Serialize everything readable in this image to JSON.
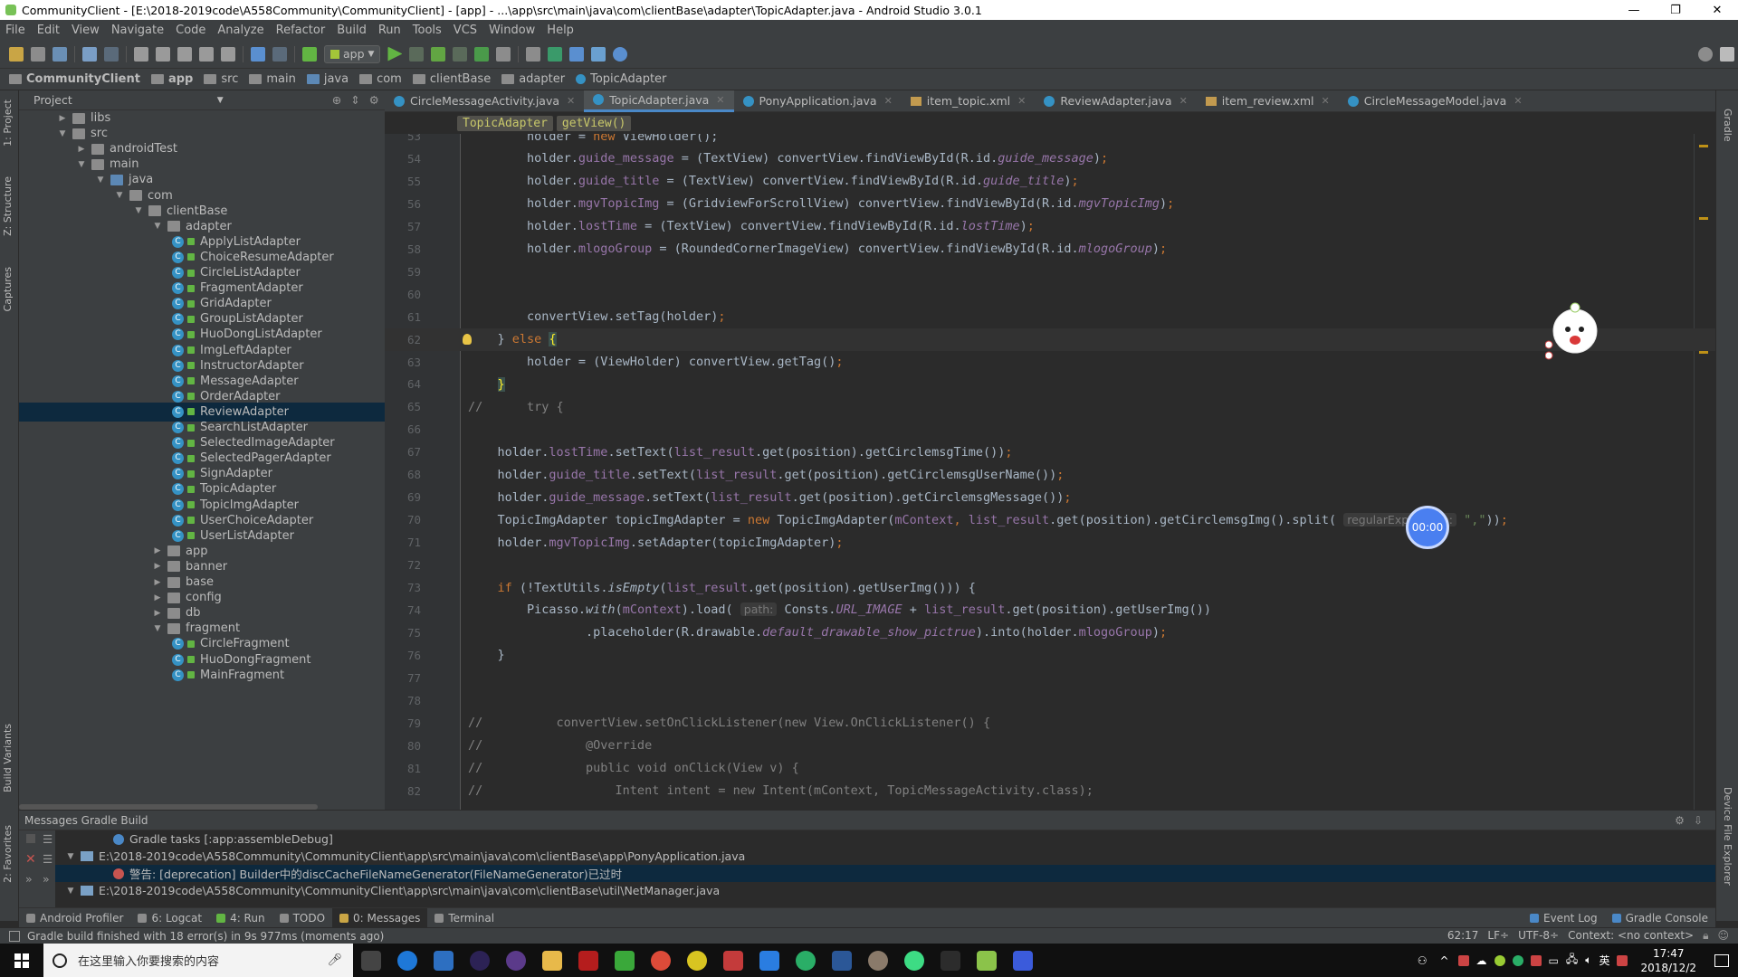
{
  "title_bar": {
    "title": "CommunityClient - [E:\\2018-2019code\\A558Community\\CommunityClient] - [app] - ...\\app\\src\\main\\java\\com\\clientBase\\adapter\\TopicAdapter.java - Android Studio 3.0.1",
    "minimize": "—",
    "maximize": "❐",
    "close": "✕"
  },
  "menu": [
    "File",
    "Edit",
    "View",
    "Navigate",
    "Code",
    "Analyze",
    "Refactor",
    "Build",
    "Run",
    "Tools",
    "VCS",
    "Window",
    "Help"
  ],
  "toolbar": {
    "app_config": "app"
  },
  "breadcrumbs": [
    "CommunityClient",
    "app",
    "src",
    "main",
    "java",
    "com",
    "clientBase",
    "adapter",
    "TopicAdapter"
  ],
  "left_strip": {
    "project": "1: Project",
    "structure": "Z: Structure",
    "captures": "Captures",
    "build_variants": "Build Variants",
    "favorites": "2: Favorites"
  },
  "right_strip": {
    "gradle": "Gradle",
    "device_explorer": "Device File Explorer"
  },
  "project_panel": {
    "header": "Project",
    "tree": [
      {
        "label": "libs",
        "depth": 3,
        "kind": "folder",
        "arrow": "▶"
      },
      {
        "label": "src",
        "depth": 3,
        "kind": "folder",
        "arrow": "▼"
      },
      {
        "label": "androidTest",
        "depth": 4,
        "kind": "folder",
        "arrow": "▶"
      },
      {
        "label": "main",
        "depth": 4,
        "kind": "folder",
        "arrow": "▼"
      },
      {
        "label": "java",
        "depth": 5,
        "kind": "bfolder",
        "arrow": "▼"
      },
      {
        "label": "com",
        "depth": 6,
        "kind": "folder",
        "arrow": "▼"
      },
      {
        "label": "clientBase",
        "depth": 7,
        "kind": "folder",
        "arrow": "▼"
      },
      {
        "label": "adapter",
        "depth": 8,
        "kind": "folder",
        "arrow": "▼"
      },
      {
        "label": "ApplyListAdapter",
        "depth": 9,
        "kind": "class"
      },
      {
        "label": "ChoiceResumeAdapter",
        "depth": 9,
        "kind": "class"
      },
      {
        "label": "CircleListAdapter",
        "depth": 9,
        "kind": "class"
      },
      {
        "label": "FragmentAdapter",
        "depth": 9,
        "kind": "class"
      },
      {
        "label": "GridAdapter",
        "depth": 9,
        "kind": "class"
      },
      {
        "label": "GroupListAdapter",
        "depth": 9,
        "kind": "class"
      },
      {
        "label": "HuoDongListAdapter",
        "depth": 9,
        "kind": "class"
      },
      {
        "label": "ImgLeftAdapter",
        "depth": 9,
        "kind": "class"
      },
      {
        "label": "InstructorAdapter",
        "depth": 9,
        "kind": "class"
      },
      {
        "label": "MessageAdapter",
        "depth": 9,
        "kind": "class"
      },
      {
        "label": "OrderAdapter",
        "depth": 9,
        "kind": "class"
      },
      {
        "label": "ReviewAdapter",
        "depth": 9,
        "kind": "class",
        "selected": true
      },
      {
        "label": "SearchListAdapter",
        "depth": 9,
        "kind": "class"
      },
      {
        "label": "SelectedImageAdapter",
        "depth": 9,
        "kind": "class"
      },
      {
        "label": "SelectedPagerAdapter",
        "depth": 9,
        "kind": "class"
      },
      {
        "label": "SignAdapter",
        "depth": 9,
        "kind": "class"
      },
      {
        "label": "TopicAdapter",
        "depth": 9,
        "kind": "class"
      },
      {
        "label": "TopicImgAdapter",
        "depth": 9,
        "kind": "class"
      },
      {
        "label": "UserChoiceAdapter",
        "depth": 9,
        "kind": "class"
      },
      {
        "label": "UserListAdapter",
        "depth": 9,
        "kind": "class"
      },
      {
        "label": "app",
        "depth": 8,
        "kind": "folder",
        "arrow": "▶"
      },
      {
        "label": "banner",
        "depth": 8,
        "kind": "folder",
        "arrow": "▶"
      },
      {
        "label": "base",
        "depth": 8,
        "kind": "folder",
        "arrow": "▶"
      },
      {
        "label": "config",
        "depth": 8,
        "kind": "folder",
        "arrow": "▶"
      },
      {
        "label": "db",
        "depth": 8,
        "kind": "folder",
        "arrow": "▶"
      },
      {
        "label": "fragment",
        "depth": 8,
        "kind": "folder",
        "arrow": "▼"
      },
      {
        "label": "CircleFragment",
        "depth": 9,
        "kind": "class"
      },
      {
        "label": "HuoDongFragment",
        "depth": 9,
        "kind": "class"
      },
      {
        "label": "MainFragment",
        "depth": 9,
        "kind": "class"
      }
    ]
  },
  "editor_tabs": [
    {
      "label": "CircleMessageActivity.java",
      "type": "java"
    },
    {
      "label": "TopicAdapter.java",
      "type": "java",
      "active": true
    },
    {
      "label": "PonyApplication.java",
      "type": "java"
    },
    {
      "label": "item_topic.xml",
      "type": "xml"
    },
    {
      "label": "ReviewAdapter.java",
      "type": "java"
    },
    {
      "label": "item_review.xml",
      "type": "xml"
    },
    {
      "label": "CircleMessageModel.java",
      "type": "java"
    }
  ],
  "editor_breadcrumb": [
    "TopicAdapter",
    "getView()"
  ],
  "code_lines": [
    {
      "n": "53",
      "html": "        holder = <span class='kw'>new</span> ViewHolder();"
    },
    {
      "n": "54",
      "html": "        holder.<span class='fld'>guide_message</span> = (TextView) convertView.findViewById(R.id.<span class='itf'>guide_message</span>)<span class='kw'>;</span>"
    },
    {
      "n": "55",
      "html": "        holder.<span class='fld'>guide_title</span> = (TextView) convertView.findViewById(R.id.<span class='itf'>guide_title</span>)<span class='kw'>;</span>"
    },
    {
      "n": "56",
      "html": "        holder.<span class='fld'>mgvTopicImg</span> = (GridviewForScrollView) convertView.findViewById(R.id.<span class='itf'>mgvTopicImg</span>)<span class='kw'>;</span>"
    },
    {
      "n": "57",
      "html": "        holder.<span class='fld'>lostTime</span> = (TextView) convertView.findViewById(R.id.<span class='itf'>lostTime</span>)<span class='kw'>;</span>"
    },
    {
      "n": "58",
      "html": "        holder.<span class='fld'>mlogoGroup</span> = (RoundedCornerImageView) convertView.findViewById(R.id.<span class='itf'>mlogoGroup</span>)<span class='kw'>;</span>"
    },
    {
      "n": "59",
      "html": ""
    },
    {
      "n": "60",
      "html": ""
    },
    {
      "n": "61",
      "html": "        convertView.setTag(holder)<span class='kw'>;</span>"
    },
    {
      "n": "62",
      "html": "    } <span class='kw'>else</span> <span class='brace'>{</span>",
      "cur": true
    },
    {
      "n": "63",
      "html": "        holder = (ViewHolder) convertView.getTag()<span class='kw'>;</span>"
    },
    {
      "n": "64",
      "html": "    <span class='brace'>}</span>"
    },
    {
      "n": "65",
      "html": "<span class='cm'>//      try {</span>"
    },
    {
      "n": "66",
      "html": ""
    },
    {
      "n": "67",
      "html": "    holder.<span class='fld'>lostTime</span>.setText(<span class='fld'>list_result</span>.get(position).getCirclemsgTime())<span class='kw'>;</span>"
    },
    {
      "n": "68",
      "html": "    holder.<span class='fld'>guide_title</span>.setText(<span class='fld'>list_result</span>.get(position).getCirclemsgUserName())<span class='kw'>;</span>"
    },
    {
      "n": "69",
      "html": "    holder.<span class='fld'>guide_message</span>.setText(<span class='fld'>list_result</span>.get(position).getCirclemsgMessage())<span class='kw'>;</span>"
    },
    {
      "n": "70",
      "html": "    TopicImgAdapter topicImgAdapter = <span class='kw'>new</span> TopicImgAdapter(<span class='fld'>mContext</span><span class='kw'>,</span> <span class='fld'>list_result</span>.get(position).getCirclemsgImg().split( <span class='hint'>regularExpression:</span> <span class='str'>\",\"</span>))<span class='kw'>;</span>"
    },
    {
      "n": "71",
      "html": "    holder.<span class='fld'>mgvTopicImg</span>.setAdapter(topicImgAdapter)<span class='kw'>;</span>"
    },
    {
      "n": "72",
      "html": ""
    },
    {
      "n": "73",
      "html": "    <span class='kw'>if</span> (!TextUtils.<span class='st'>isEmpty</span>(<span class='fld'>list_result</span>.get(position).getUserImg())) {"
    },
    {
      "n": "74",
      "html": "        Picasso.<span class='st'>with</span>(<span class='fld'>mContext</span>).load( <span class='hint'>path:</span> Consts.<span class='itf'>URL_IMAGE</span> + <span class='fld'>list_result</span>.get(position).getUserImg())"
    },
    {
      "n": "75",
      "html": "                .placeholder(R.drawable.<span class='itf'>default_drawable_show_pictrue</span>).into(holder.<span class='fld'>mlogoGroup</span>)<span class='kw'>;</span>"
    },
    {
      "n": "76",
      "html": "    }"
    },
    {
      "n": "77",
      "html": ""
    },
    {
      "n": "78",
      "html": ""
    },
    {
      "n": "79",
      "html": "<span class='cm'>//          convertView.setOnClickListener(new View.OnClickListener() {</span>"
    },
    {
      "n": "80",
      "html": "<span class='cm'>//              @Override</span>"
    },
    {
      "n": "81",
      "html": "<span class='cm'>//              public void onClick(View v) {</span>"
    },
    {
      "n": "82",
      "html": "<span class='cm'>//                  Intent intent = new Intent(mContext, TopicMessageActivity.class);</span>"
    }
  ],
  "timer_overlay": "00:00",
  "messages_panel": {
    "header": "Messages Gradle Build",
    "rows": [
      {
        "icon": "info",
        "text": "Gradle tasks [:app:assembleDebug]"
      },
      {
        "icon": "file",
        "text": "E:\\2018-2019code\\A558Community\\CommunityClient\\app\\src\\main\\java\\com\\clientBase\\app\\PonyApplication.java",
        "arrow": "▼"
      },
      {
        "icon": "error",
        "text": "警告: [deprecation] Builder中的discCacheFileNameGenerator(FileNameGenerator)已过时",
        "selected": true
      },
      {
        "icon": "file",
        "text": "E:\\2018-2019code\\A558Community\\CommunityClient\\app\\src\\main\\java\\com\\clientBase\\util\\NetManager.java",
        "arrow": "▼"
      }
    ]
  },
  "tool_windows": [
    {
      "label": "Android Profiler",
      "color": "#8c8c8c"
    },
    {
      "label": "6: Logcat",
      "color": "#8c8c8c"
    },
    {
      "label": "4: Run",
      "color": "#62b543"
    },
    {
      "label": "TODO",
      "color": "#8c8c8c"
    },
    {
      "label": "0: Messages",
      "color": "#c9a545",
      "active": true
    },
    {
      "label": "Terminal",
      "color": "#8c8c8c"
    }
  ],
  "tool_windows_right": [
    {
      "label": "Event Log"
    },
    {
      "label": "Gradle Console"
    }
  ],
  "status_bar": {
    "message": "Gradle build finished with 18 error(s) in 9s 977ms (moments ago)",
    "position": "62:17",
    "line_sep": "LF÷",
    "encoding": "UTF-8÷",
    "context": "Context: <no context>"
  },
  "taskbar": {
    "search_placeholder": "在这里输入你要搜索的内容",
    "time": "17:47",
    "date": "2018/12/2",
    "ime": "英",
    "apps": [
      {
        "name": "task-view",
        "color": "#444444"
      },
      {
        "name": "edge",
        "color": "#1e78d8"
      },
      {
        "name": "store",
        "color": "#2d6fc1"
      },
      {
        "name": "eclipse",
        "color": "#2c2255"
      },
      {
        "name": "eclipse2",
        "color": "#5b3a8a"
      },
      {
        "name": "file-explorer",
        "color": "#e8b94a"
      },
      {
        "name": "app-red",
        "color": "#b51d1d"
      },
      {
        "name": "app-green",
        "color": "#3aa83a"
      },
      {
        "name": "chrome",
        "color": "#dd4b39"
      },
      {
        "name": "app-yellow",
        "color": "#d8c421"
      },
      {
        "name": "app-mascot",
        "color": "#c43b3b"
      },
      {
        "name": "app-blue",
        "color": "#2a7de1"
      },
      {
        "name": "wechat",
        "color": "#2aae67"
      },
      {
        "name": "word",
        "color": "#2b5797"
      },
      {
        "name": "app-avatar",
        "color": "#8a7a6a"
      },
      {
        "name": "android-studio",
        "color": "#3ddc84"
      },
      {
        "name": "terminal",
        "color": "#2c2c2c"
      },
      {
        "name": "app-layers",
        "color": "#8bc34a"
      },
      {
        "name": "app-s",
        "color": "#3b5bdb"
      }
    ]
  },
  "colors": {
    "accent": "#4a88c7",
    "selection": "#0d293e",
    "keyword": "#cc7832",
    "field": "#9876aa"
  }
}
